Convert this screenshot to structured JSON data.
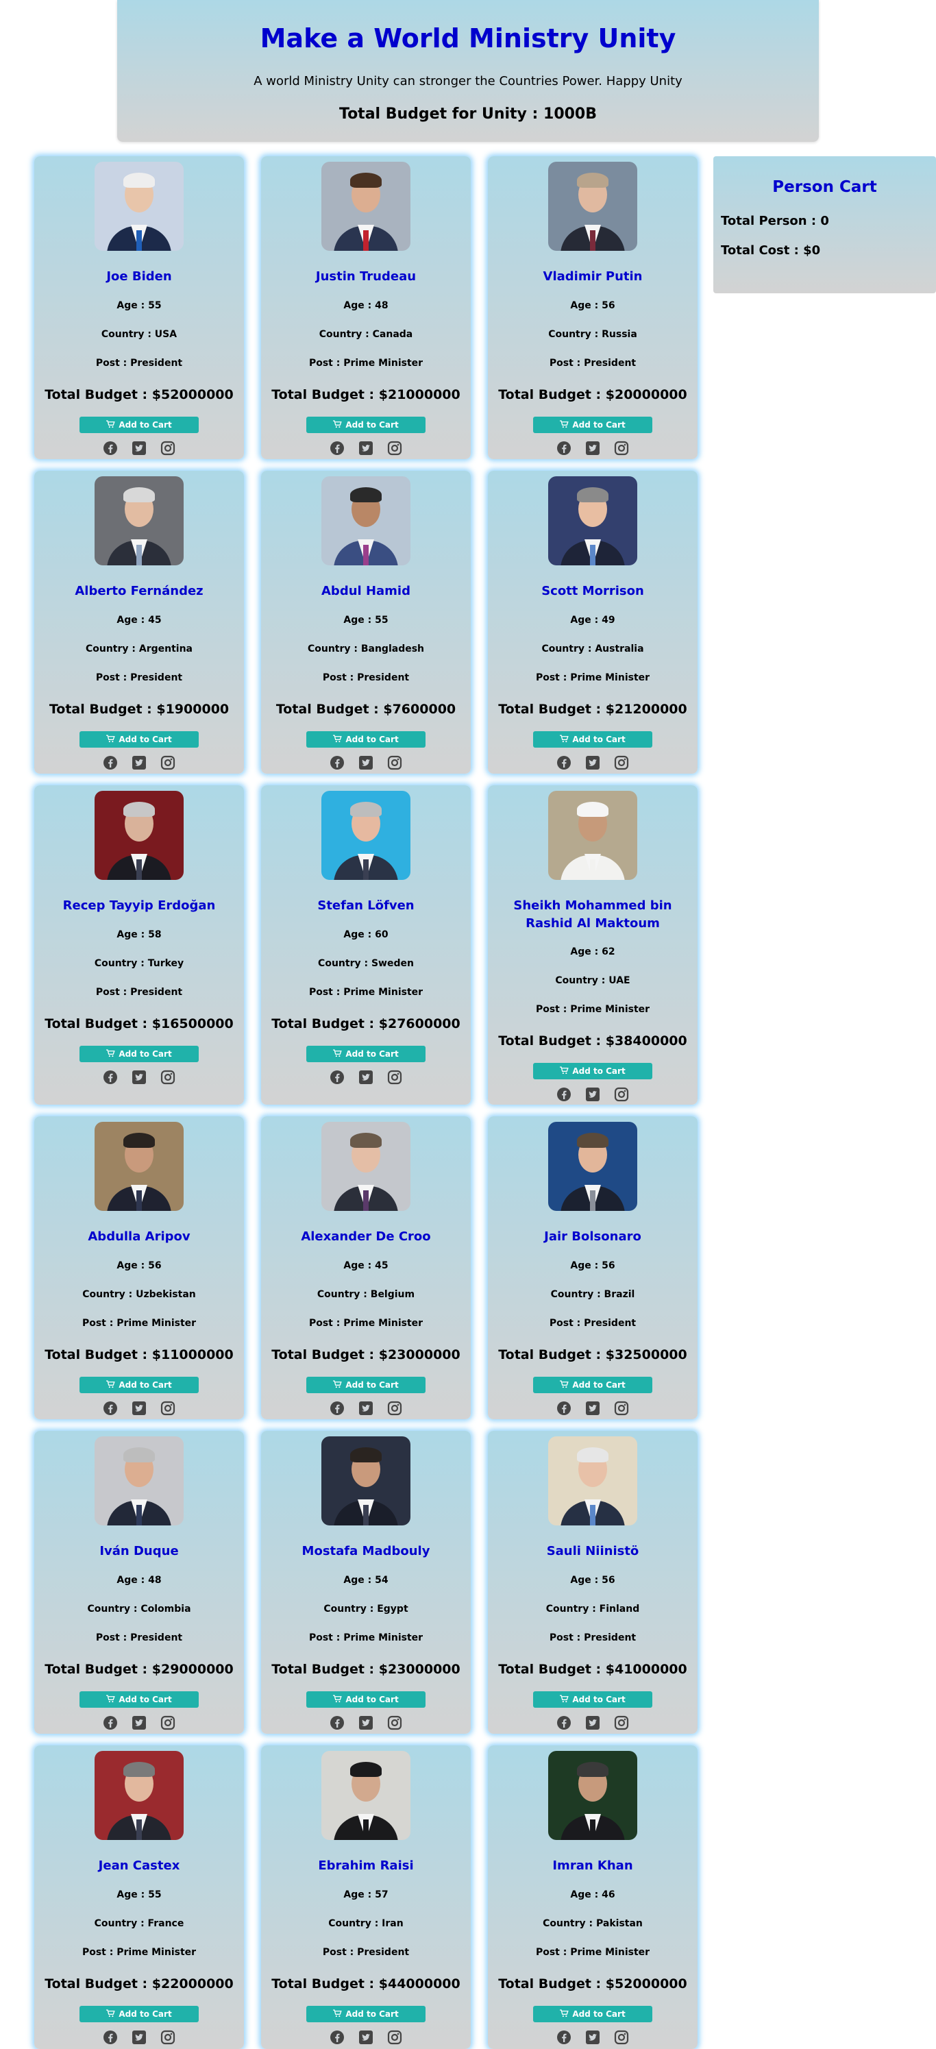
{
  "header": {
    "title": "Make a World Ministry Unity",
    "subtitle": "A world Ministry Unity can stronger the Countries Power. Happy Unity",
    "total_budget": "Total Budget for Unity : 1000B"
  },
  "cart": {
    "title": "Person Cart",
    "total_person": "Total Person : 0",
    "total_cost": "Total Cost : $0"
  },
  "button_label": "Add to Cart",
  "social_icons": [
    "facebook-icon",
    "twitter-icon",
    "instagram-icon"
  ],
  "people": [
    {
      "name": "Joe Biden",
      "age": "Age : 55",
      "country": "Country : USA",
      "post": "Post : President",
      "budget": "Total Budget : $52000000",
      "photo": {
        "bg": "#c9d4e4",
        "suit": "#1c2a4a",
        "tie": "#1f5fb8",
        "skin": "#e8c5aa",
        "hair": "#eeeeee"
      }
    },
    {
      "name": "Justin Trudeau",
      "age": "Age : 48",
      "country": "Country : Canada",
      "post": "Post : Prime Minister",
      "budget": "Total Budget : $21000000",
      "photo": {
        "bg": "#a9b3bf",
        "suit": "#2a3550",
        "tie": "#c2222e",
        "skin": "#dcae91",
        "hair": "#4a3222"
      }
    },
    {
      "name": "Vladimir Putin",
      "age": "Age : 56",
      "country": "Country : Russia",
      "post": "Post : President",
      "budget": "Total Budget : $20000000",
      "photo": {
        "bg": "#7b8c9e",
        "suit": "#262a36",
        "tie": "#7a2b3b",
        "skin": "#e0b9a0",
        "hair": "#b8a48c"
      }
    },
    {
      "name": "Alberto Fernández",
      "age": "Age : 45",
      "country": "Country : Argentina",
      "post": "Post : President",
      "budget": "Total Budget : $1900000",
      "photo": {
        "bg": "#6d6f74",
        "suit": "#2b2f3a",
        "tie": "#8fa4bf",
        "skin": "#e2bca2",
        "hair": "#d8d8d8"
      }
    },
    {
      "name": "Abdul Hamid",
      "age": "Age : 55",
      "country": "Country : Bangladesh",
      "post": "Post : President",
      "budget": "Total Budget : $7600000",
      "photo": {
        "bg": "#b8c6d4",
        "suit": "#3a4e82",
        "tie": "#9a3f8c",
        "skin": "#b98766",
        "hair": "#2a2a2a"
      }
    },
    {
      "name": "Scott Morrison",
      "age": "Age : 49",
      "country": "Country : Australia",
      "post": "Post : Prime Minister",
      "budget": "Total Budget : $21200000",
      "photo": {
        "bg": "#33406e",
        "suit": "#1e2438",
        "tie": "#5b87c9",
        "skin": "#e8bea2",
        "hair": "#8a8a8a"
      }
    },
    {
      "name": "Recep Tayyip Erdoğan",
      "age": "Age : 58",
      "country": "Country : Turkey",
      "post": "Post : President",
      "budget": "Total Budget : $16500000",
      "photo": {
        "bg": "#7a1a1f",
        "suit": "#1b1b22",
        "tie": "#3a3f52",
        "skin": "#d9b29a",
        "hair": "#c7c7c7"
      }
    },
    {
      "name": "Stefan Löfven",
      "age": "Age : 60",
      "country": "Country : Sweden",
      "post": "Post : Prime Minister",
      "budget": "Total Budget : $27600000",
      "photo": {
        "bg": "#2fb0e0",
        "suit": "#2a3346",
        "tie": "#3a3f52",
        "skin": "#e6b9a0",
        "hair": "#bdbdbd"
      }
    },
    {
      "name": "Sheikh Mohammed bin Rashid Al Maktoum",
      "age": "Age : 62",
      "country": "Country : UAE",
      "post": "Post : Prime Minister",
      "budget": "Total Budget : $38400000",
      "photo": {
        "bg": "#b5a98f",
        "suit": "#f2f2f0",
        "tie": "#f2f2f0",
        "skin": "#c69a7a",
        "hair": "#f5f5f5"
      }
    },
    {
      "name": "Abdulla Aripov",
      "age": "Age : 56",
      "country": "Country : Uzbekistan",
      "post": "Post : Prime Minister",
      "budget": "Total Budget : $11000000",
      "photo": {
        "bg": "#9d8462",
        "suit": "#1f2230",
        "tie": "#2e3650",
        "skin": "#c99a7c",
        "hair": "#2a2420"
      }
    },
    {
      "name": "Alexander De Croo",
      "age": "Age : 45",
      "country": "Country : Belgium",
      "post": "Post : Prime Minister",
      "budget": "Total Budget : $23000000",
      "photo": {
        "bg": "#c4c7cc",
        "suit": "#2b2f3a",
        "tie": "#5a3a6a",
        "skin": "#e4bea6",
        "hair": "#6a5a4a"
      }
    },
    {
      "name": "Jair Bolsonaro",
      "age": "Age : 56",
      "country": "Country : Brazil",
      "post": "Post : President",
      "budget": "Total Budget : $32500000",
      "photo": {
        "bg": "#1f4a86",
        "suit": "#1b2130",
        "tie": "#8a8f9a",
        "skin": "#e2b69a",
        "hair": "#5a4a3a"
      }
    },
    {
      "name": "Iván Duque",
      "age": "Age : 48",
      "country": "Country : Colombia",
      "post": "Post : President",
      "budget": "Total Budget : $29000000",
      "photo": {
        "bg": "#c7c8cc",
        "suit": "#222838",
        "tie": "#2e3a5a",
        "skin": "#dcae91",
        "hair": "#bdbdbd"
      }
    },
    {
      "name": "Mostafa Madbouly",
      "age": "Age : 54",
      "country": "Country : Egypt",
      "post": "Post : Prime Minister",
      "budget": "Total Budget : $23000000",
      "photo": {
        "bg": "#2a3142",
        "suit": "#1a1e2a",
        "tie": "#3a3f52",
        "skin": "#c99a7c",
        "hair": "#2a2420"
      }
    },
    {
      "name": "Sauli Niinistö",
      "age": "Age : 56",
      "country": "Country : Finland",
      "post": "Post : President",
      "budget": "Total Budget : $41000000",
      "photo": {
        "bg": "#e2d9c4",
        "suit": "#263044",
        "tie": "#5b87c9",
        "skin": "#e8c1a8",
        "hair": "#e6e6e6"
      }
    },
    {
      "name": "Jean Castex",
      "age": "Age : 55",
      "country": "Country : France",
      "post": "Post : Prime Minister",
      "budget": "Total Budget : $22000000",
      "photo": {
        "bg": "#9a2a2e",
        "suit": "#23252e",
        "tie": "#3a3f52",
        "skin": "#e2b89e",
        "hair": "#7a7a7a"
      }
    },
    {
      "name": "Ebrahim Raisi",
      "age": "Age : 57",
      "country": "Country : Iran",
      "post": "Post : President",
      "budget": "Total Budget : $44000000",
      "photo": {
        "bg": "#d6d6d2",
        "suit": "#1a1a1c",
        "tie": "#1a1a1c",
        "skin": "#d2a98e",
        "hair": "#1a1a1c"
      }
    },
    {
      "name": "Imran Khan",
      "age": "Age : 46",
      "country": "Country : Pakistan",
      "post": "Post : Prime Minister",
      "budget": "Total Budget : $52000000",
      "photo": {
        "bg": "#1e3a24",
        "suit": "#1a1a1e",
        "tie": "#1a1a1e",
        "skin": "#c79a7c",
        "hair": "#3a3a3a"
      }
    }
  ]
}
